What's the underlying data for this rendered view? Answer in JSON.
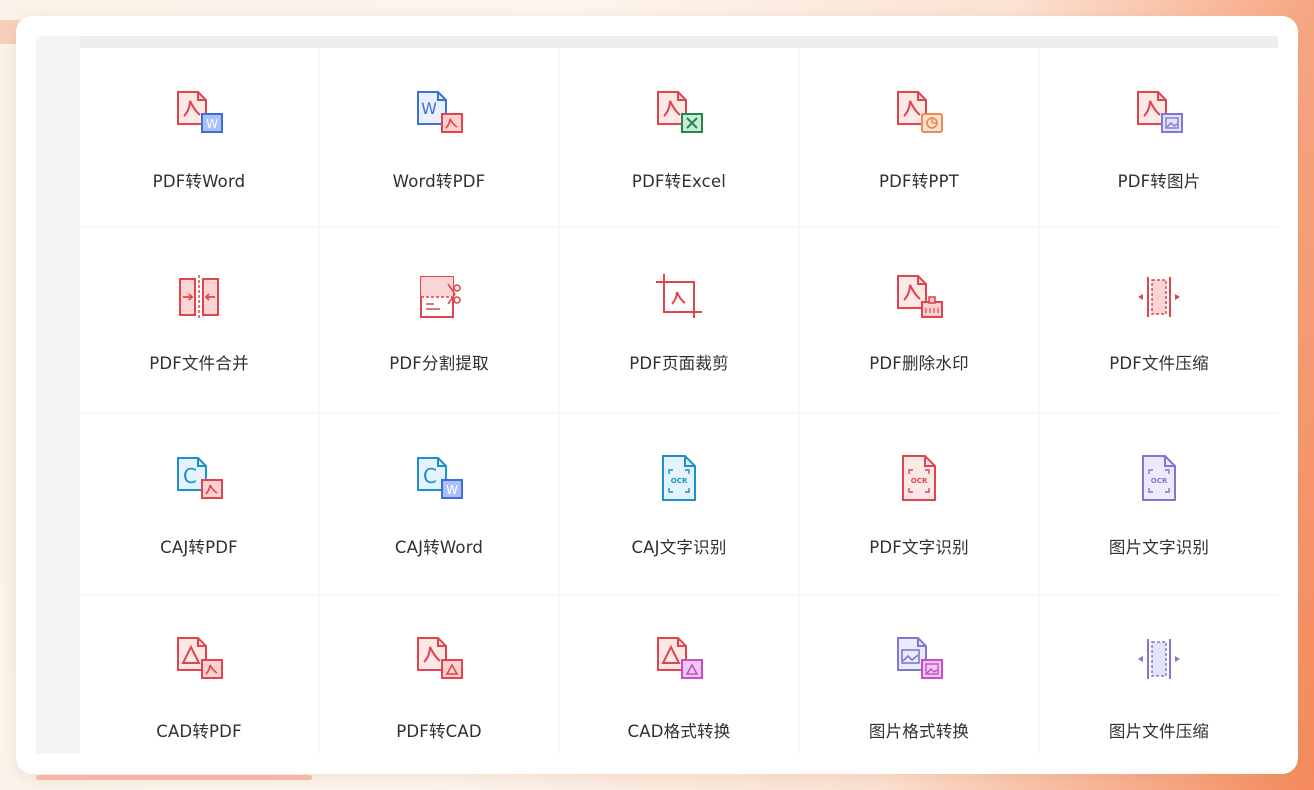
{
  "colors": {
    "pdf_red": "#e0454b",
    "pdf_fill": "#fde8e8",
    "word_blue": "#3e6fd6",
    "word_fill": "#a9c1f6",
    "excel_green": "#1f8a4c",
    "excel_fill": "#cfe9d7",
    "ppt_orange": "#f08a54",
    "img_purple": "#7b78d6",
    "caj_teal": "#1d8fc9",
    "cad_pink": "#c24fc4"
  },
  "tools": [
    {
      "label": "PDF转Word",
      "icon": "pdf-to-word-icon"
    },
    {
      "label": "Word转PDF",
      "icon": "word-to-pdf-icon"
    },
    {
      "label": "PDF转Excel",
      "icon": "pdf-to-excel-icon"
    },
    {
      "label": "PDF转PPT",
      "icon": "pdf-to-ppt-icon"
    },
    {
      "label": "PDF转图片",
      "icon": "pdf-to-image-icon"
    },
    {
      "label": "PDF文件合并",
      "icon": "pdf-merge-icon"
    },
    {
      "label": "PDF分割提取",
      "icon": "pdf-split-icon"
    },
    {
      "label": "PDF页面裁剪",
      "icon": "pdf-crop-icon"
    },
    {
      "label": "PDF删除水印",
      "icon": "pdf-remove-watermark-icon"
    },
    {
      "label": "PDF文件压缩",
      "icon": "pdf-compress-icon"
    },
    {
      "label": "CAJ转PDF",
      "icon": "caj-to-pdf-icon"
    },
    {
      "label": "CAJ转Word",
      "icon": "caj-to-word-icon"
    },
    {
      "label": "CAJ文字识别",
      "icon": "caj-ocr-icon",
      "badge": "OCR"
    },
    {
      "label": "PDF文字识别",
      "icon": "pdf-ocr-icon",
      "badge": "OCR"
    },
    {
      "label": "图片文字识别",
      "icon": "image-ocr-icon",
      "badge": "OCR"
    },
    {
      "label": "CAD转PDF",
      "icon": "cad-to-pdf-icon"
    },
    {
      "label": "PDF转CAD",
      "icon": "pdf-to-cad-icon"
    },
    {
      "label": "CAD格式转换",
      "icon": "cad-convert-icon"
    },
    {
      "label": "图片格式转换",
      "icon": "image-convert-icon"
    },
    {
      "label": "图片文件压缩",
      "icon": "image-compress-icon"
    }
  ]
}
